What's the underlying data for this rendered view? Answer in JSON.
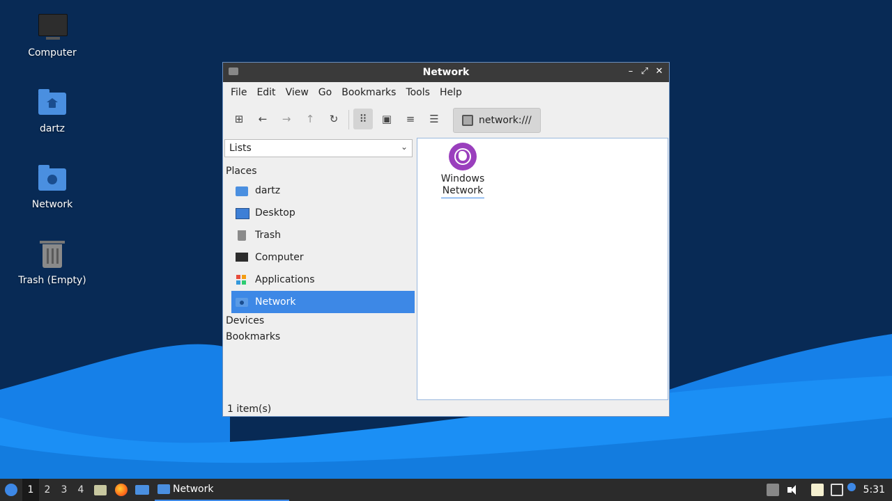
{
  "desktop": {
    "icons": [
      {
        "label": "Computer",
        "icon": "computer-icon"
      },
      {
        "label": "dartz",
        "icon": "home-folder-icon"
      },
      {
        "label": "Network",
        "icon": "network-folder-icon"
      },
      {
        "label": "Trash (Empty)",
        "icon": "trash-icon"
      }
    ]
  },
  "window": {
    "title": "Network",
    "controls": {
      "minimize": "–",
      "maximize": "⤢",
      "close": "✕"
    },
    "menu": [
      "File",
      "Edit",
      "View",
      "Go",
      "Bookmarks",
      "Tools",
      "Help"
    ],
    "toolbar": {
      "new_window": "⊞",
      "back": "←",
      "forward": "→",
      "up": "↑",
      "reload": "↻",
      "icon_view": "⠿",
      "thumbnail_view": "▣",
      "compact_view": "≡",
      "detailed_view": "☰"
    },
    "location": "network:///",
    "side_pane": {
      "selector": "Lists",
      "chevron": "⌄",
      "places_header": "Places",
      "places": [
        {
          "label": "dartz",
          "icon": "home-folder-icon"
        },
        {
          "label": "Desktop",
          "icon": "desktop-icon"
        },
        {
          "label": "Trash",
          "icon": "trash-icon"
        },
        {
          "label": "Computer",
          "icon": "computer-icon"
        },
        {
          "label": "Applications",
          "icon": "applications-icon"
        },
        {
          "label": "Network",
          "icon": "network-icon"
        }
      ],
      "selected": "Network",
      "devices_header": "Devices",
      "bookmarks_header": "Bookmarks"
    },
    "content": {
      "items": [
        {
          "label": "Windows Network",
          "icon": "windows-network-icon"
        }
      ]
    },
    "status": "1 item(s)"
  },
  "taskbar": {
    "workspaces": [
      "1",
      "2",
      "3",
      "4"
    ],
    "active_workspace": "1",
    "task": "Network",
    "clock": "5:31"
  },
  "colors": {
    "accent": "#3d88e6",
    "titlebar": "#3a3a3a",
    "taskbar": "#2b2b2b",
    "wallpaper_dark": "#082a55",
    "wallpaper_wave": "#1a8ff0"
  }
}
